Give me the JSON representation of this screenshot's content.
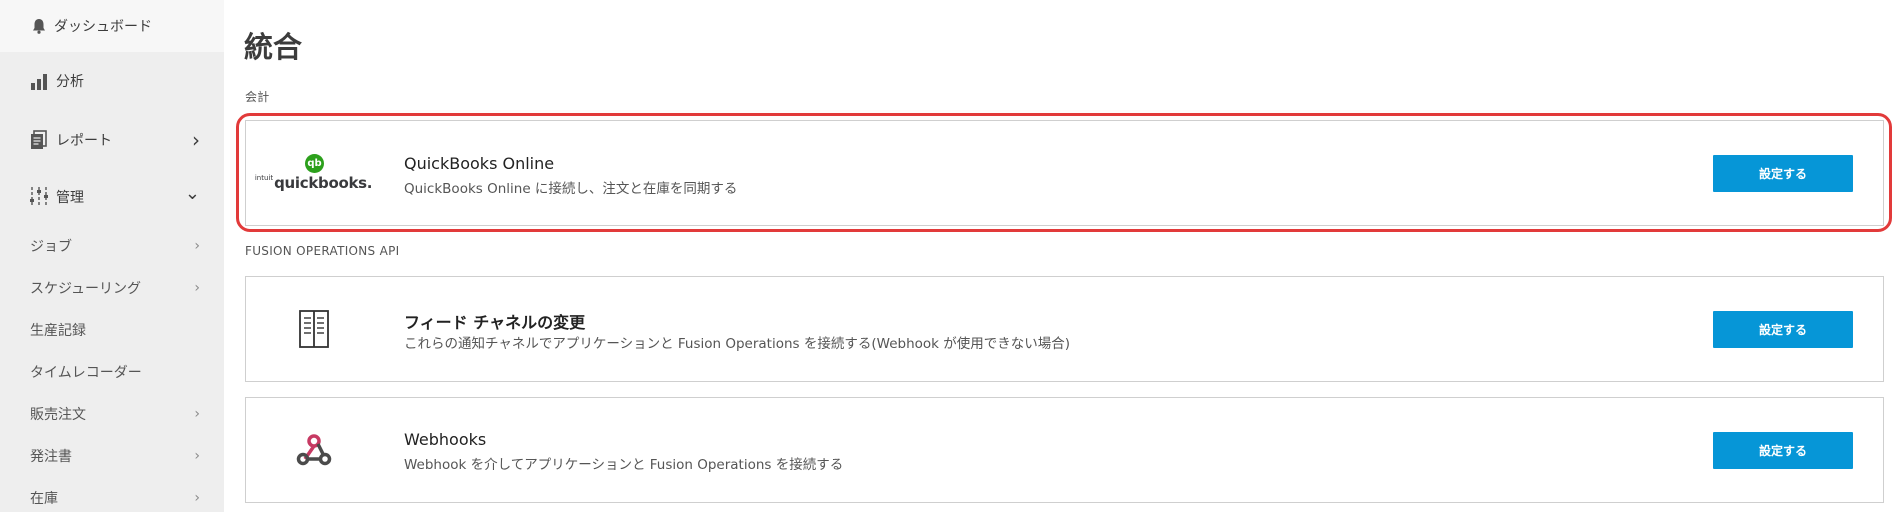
{
  "sidebar": {
    "top": {
      "label": "ダッシュボード",
      "icon": "bell-icon"
    },
    "items": [
      {
        "label": "分析",
        "icon": "bar-chart-icon",
        "chevron": ""
      },
      {
        "label": "レポート",
        "icon": "report-icon",
        "chevron": "›"
      },
      {
        "label": "管理",
        "icon": "sliders-icon",
        "chevron": "⌄"
      }
    ],
    "subitems": [
      {
        "label": "ジョブ",
        "chevron": "›"
      },
      {
        "label": "スケジューリング",
        "chevron": "›"
      },
      {
        "label": "生産記録",
        "chevron": ""
      },
      {
        "label": "タイムレコーダー",
        "chevron": ""
      },
      {
        "label": "販売注文",
        "chevron": "›"
      },
      {
        "label": "発注書",
        "chevron": "›"
      },
      {
        "label": "在庫",
        "chevron": "›"
      }
    ]
  },
  "main": {
    "title": "統合",
    "sections": [
      {
        "label": "会計",
        "cards": [
          {
            "name": "QuickBooks Online",
            "description": "QuickBooks Online に接続し、注文と在庫を同期する",
            "button": "設定する",
            "logo": {
              "badge": "qb",
              "small": "intuit",
              "text": "quickbooks."
            }
          }
        ]
      },
      {
        "label": "FUSION OPERATIONS API",
        "cards": [
          {
            "name": "フィード チャネルの変更",
            "description": "これらの通知チャネルでアプリケーションと Fusion Operations を接続する(Webhook が使用できない場合)",
            "button": "設定する",
            "icon": "book-icon"
          },
          {
            "name": "Webhooks",
            "description": "Webhook を介してアプリケーションと Fusion Operations を接続する",
            "button": "設定する",
            "icon": "webhook-icon"
          }
        ]
      }
    ]
  },
  "colors": {
    "accent": "#0696d7",
    "highlight": "#e23a3a",
    "qb_green": "#2ca01c",
    "webhook_pink": "#c73a63",
    "webhook_dark": "#4b4b4b",
    "sidebar_bg": "#eeeeee"
  }
}
